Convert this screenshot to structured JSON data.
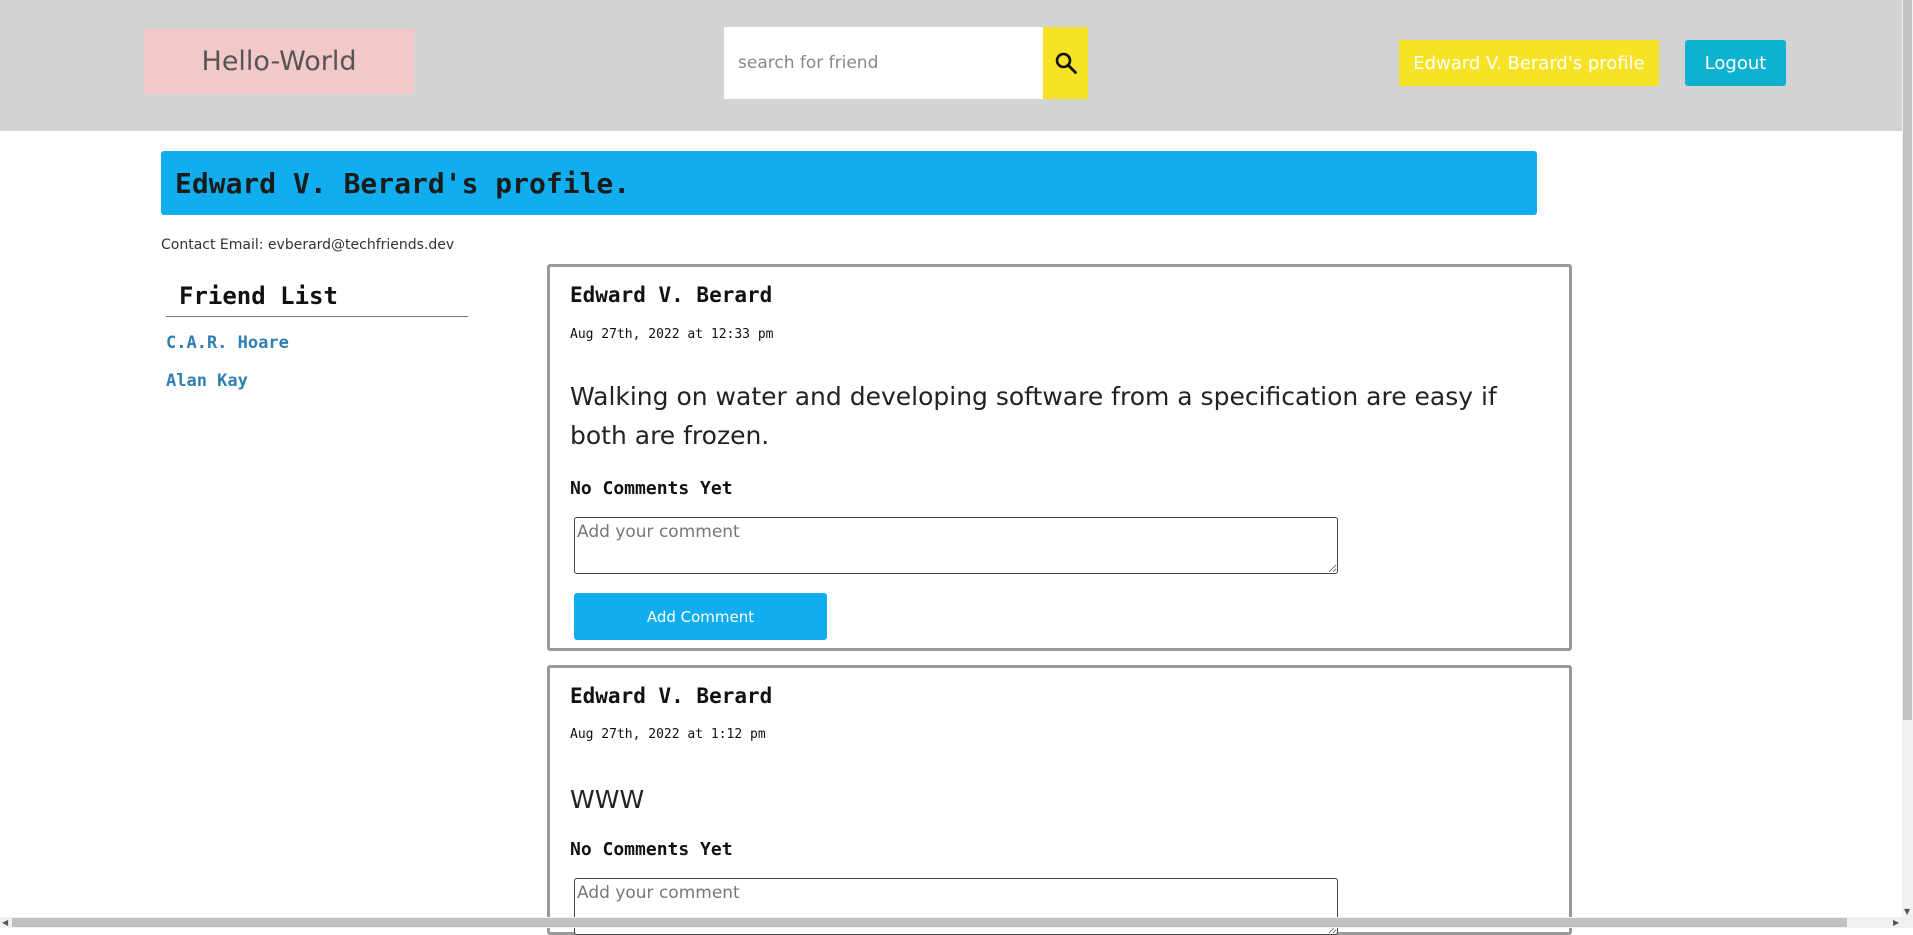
{
  "header": {
    "logo": "Hello-World",
    "search_placeholder": "search for friend",
    "search_icon": "search-icon",
    "profile_button": "Edward V. Berard's profile",
    "logout_button": "Logout"
  },
  "profile": {
    "title": "Edward V. Berard's profile.",
    "contact": "Contact Email: evberard@techfriends.dev"
  },
  "friends": {
    "title": "Friend List",
    "items": [
      "C.A.R. Hoare",
      "Alan Kay"
    ]
  },
  "posts": [
    {
      "author": "Edward V. Berard",
      "date": "Aug 27th, 2022 at 12:33 pm",
      "text": "Walking on water and developing software from a specification are easy if both are frozen.",
      "comments_status": "No Comments Yet",
      "comment_placeholder": "Add your comment",
      "add_button": "Add Comment"
    },
    {
      "author": "Edward V. Berard",
      "date": "Aug 27th, 2022 at 1:12 pm",
      "text": "WWW",
      "comments_status": "No Comments Yet",
      "comment_placeholder": "Add your comment"
    }
  ],
  "colors": {
    "header_bg": "#d3d3d3",
    "logo_bg": "#f2c8c8",
    "accent_yellow": "#f7e326",
    "logout_bg": "#0cb2cf",
    "banner_bg": "#10aeef",
    "link": "#2f7fb0"
  }
}
